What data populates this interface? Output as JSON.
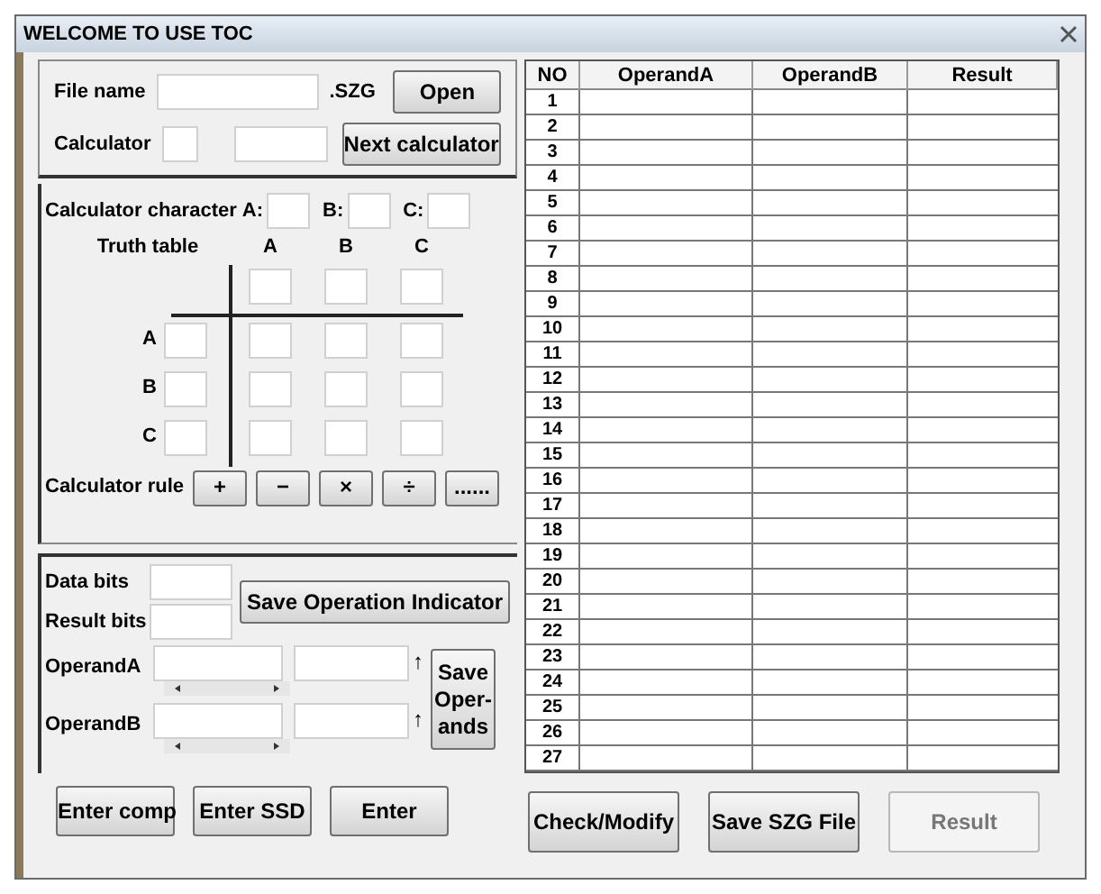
{
  "window": {
    "title": "WELCOME TO USE TOC"
  },
  "file": {
    "label": "File name",
    "extension": ".SZG",
    "open_button": "Open"
  },
  "calculator": {
    "label": "Calculator",
    "next_button": "Next calculator"
  },
  "characters": {
    "label": "Calculator character",
    "fields": [
      "A:",
      "B:",
      "C:"
    ]
  },
  "truth_table": {
    "label": "Truth table",
    "columns": [
      "A",
      "B",
      "C"
    ],
    "rows": [
      "A",
      "B",
      "C"
    ]
  },
  "rule": {
    "label": "Calculator rule",
    "buttons": [
      "+",
      "−",
      "×",
      "÷",
      "......"
    ]
  },
  "bits": [
    {
      "label": "Data bits"
    },
    {
      "label": "Result bits"
    }
  ],
  "save_indicator_button": "Save Operation Indicator",
  "operands": [
    {
      "label": "OperandA",
      "arrow": "↑"
    },
    {
      "label": "OperandB",
      "arrow": "↑"
    }
  ],
  "save_operands_button": "Save\nOper-\nands",
  "left_buttons": [
    {
      "label": "Enter comp",
      "disabled": false
    },
    {
      "label": "Enter SSD",
      "disabled": false
    },
    {
      "label": "Enter",
      "disabled": false
    }
  ],
  "table": {
    "columns": [
      "NO",
      "OperandA",
      "OperandB",
      "Result"
    ],
    "rows": [
      "1",
      "2",
      "3",
      "4",
      "5",
      "6",
      "7",
      "8",
      "9",
      "10",
      "11",
      "12",
      "13",
      "14",
      "15",
      "16",
      "17",
      "18",
      "19",
      "20",
      "21",
      "22",
      "23",
      "24",
      "25",
      "26",
      "27"
    ]
  },
  "right_buttons": [
    {
      "label": "Check/Modify",
      "disabled": false
    },
    {
      "label": "Save SZG File",
      "disabled": false
    },
    {
      "label": "Result",
      "disabled": true
    }
  ]
}
